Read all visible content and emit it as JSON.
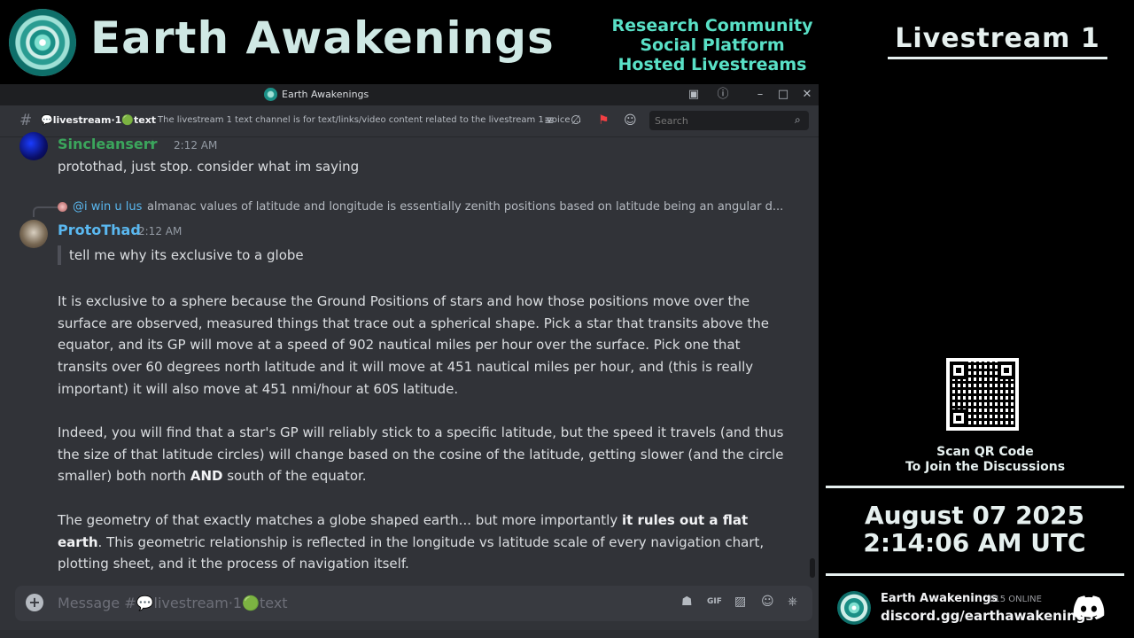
{
  "banner": {
    "brand_title": "Earth Awakenings",
    "tagline_1": "Research Community",
    "tagline_2": "Social Platform",
    "tagline_3": "Hosted Livestreams",
    "livestream_title": "Livestream 1"
  },
  "window": {
    "title": "Earth Awakenings",
    "channel_name": "💬livestream·1🟢text",
    "topic": "The livestream 1 text channel is for text/links/video content related to the livestream 1 voice ...",
    "search_placeholder": "Search"
  },
  "messages": [
    {
      "username": "Sincleanserr",
      "timestamp": "2:12 AM",
      "text": "protothad, just stop. consider what im saying"
    },
    {
      "reply_user": "@i win u lus",
      "reply_text": "almanac values of latitude and longitude is essentially zenith positions based on latitude being an angular d...",
      "username": "ProtoThad",
      "timestamp": "2:12 AM",
      "quote": "tell me why its exclusive to a globe",
      "para1": "It is exclusive to a sphere because the Ground Positions of stars and how those positions move over the surface are observed, measured things that trace out a spherical shape. Pick a star that transits above the equator, and its GP will move at a speed of 902 nautical miles per hour over the surface. Pick one that transits over 60 degrees north latitude and it will move at 451 nautical miles per hour, and (this is really important) it will also move at 451 nmi/hour at 60S latitude.",
      "para2_a": "Indeed, you will find that a star's GP will reliably stick to a specific latitude, but the speed it travels (and thus the size of that latitude circles) will change based on the cosine of the latitude, getting slower (and the circle smaller) both north ",
      "para2_bold": "AND",
      "para2_b": " south of the equator.",
      "para3_a": "The geometry of that exactly matches a globe shaped earth... but more importantly ",
      "para3_bold": "it rules out a flat earth",
      "para3_b": ".  This geometric relationship is reflected in the longitude vs latitude scale of every navigation chart, plotting sheet, and it the process of navigation itself."
    }
  ],
  "composer": {
    "placeholder": "Message #💬livestream·1🟢text"
  },
  "sidebar": {
    "scan_line_1": "Scan QR Code",
    "scan_line_2": "To Join the Discussions",
    "date": "August 07 2025",
    "time": "2:14:06 AM UTC",
    "server_name": "Earth Awakenings",
    "online_count": "615 ONLINE",
    "invite": "discord.gg/earthawakenings"
  },
  "colors": {
    "accent_teal": "#59e0c6",
    "user_green": "#3ba55c",
    "user_blue": "#5ab8f0",
    "discord_bg": "#313338"
  },
  "icons": [
    "inbox-icon",
    "help-icon",
    "minimize-icon",
    "maximize-icon",
    "close-icon",
    "hash-icon",
    "threads-icon",
    "mute-icon",
    "pin-icon",
    "members-icon",
    "search-icon",
    "plus-icon",
    "gift-icon",
    "gif-icon",
    "sticker-icon",
    "emoji-icon",
    "activity-icon",
    "discord-logo-icon",
    "qr-code-icon"
  ]
}
